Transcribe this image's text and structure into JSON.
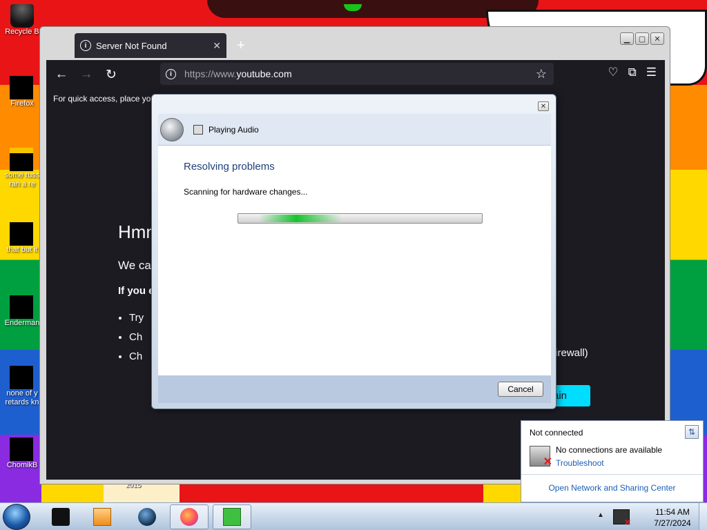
{
  "desktop": {
    "icons": [
      {
        "label": "Recycle B",
        "icon": "recycle-bin-icon"
      },
      {
        "label": "Firefox",
        "icon": "firefox-icon"
      },
      {
        "label": "some russ",
        "label2": "ran a re",
        "icon": "document-icon"
      },
      {
        "label": "that but it",
        "icon": "folder-icon"
      },
      {
        "label": "Enderman",
        "icon": "terminal-icon"
      },
      {
        "label": "none of y",
        "label2": "retards kn",
        "icon": "chrome-icon"
      },
      {
        "label": "ChomikB",
        "icon": "game-icon"
      }
    ],
    "wallpaper_year": "2015"
  },
  "browser": {
    "tab_title": "Server Not Found",
    "tab_close": "✕",
    "new_tab": "+",
    "url_scheme": "https://www.",
    "url_host": "youtube.com",
    "bookmarks_hint": "For quick access, place you",
    "error": {
      "title": "Hmm",
      "message": "We ca",
      "hint": "If you e",
      "bullets": [
        "Try",
        "Ch",
        "Ch"
      ],
      "firewall": "firewall)",
      "try_again": "Try Again",
      "try_again_visible": "ain"
    }
  },
  "dialog": {
    "app_title": "Playing Audio",
    "heading": "Resolving problems",
    "status": "Scanning for hardware changes...",
    "cancel": "Cancel",
    "progress_state": "indeterminate"
  },
  "network_popup": {
    "status": "Not connected",
    "message": "No connections are available",
    "troubleshoot": "Troubleshoot",
    "center_link": "Open Network and Sharing Center"
  },
  "taskbar": {
    "time": "11:54 AM",
    "date": "7/27/2024"
  },
  "colors": {
    "link": "#1a5fb4",
    "dialog_heading": "#1e3f7a",
    "try_again_bg": "#00ddff",
    "browser_bg": "#1c1b22"
  }
}
